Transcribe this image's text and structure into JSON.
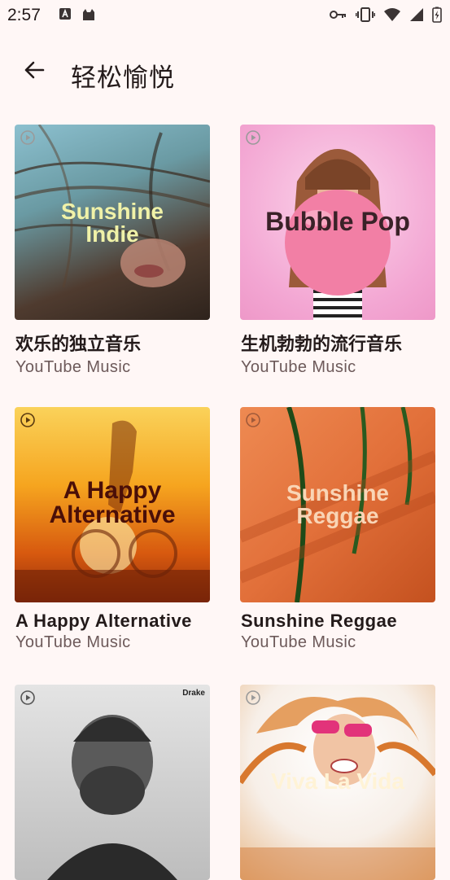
{
  "status": {
    "time": "2:57",
    "left_icons": [
      "font-a-icon",
      "cat-icon"
    ],
    "right_icons": [
      "key-icon",
      "vibrate-icon",
      "wifi-icon",
      "signal-icon",
      "battery-charging-icon"
    ]
  },
  "header": {
    "title": "轻松愉悦",
    "back_icon": "arrow-left-icon"
  },
  "playlists": [
    {
      "title": "欢乐的独立音乐",
      "subtitle": "YouTube Music",
      "art_text": "Sunshine Indie",
      "art_colors": [
        "#7fb2c2",
        "#5e4a3a"
      ]
    },
    {
      "title": "生机勃勃的流行音乐",
      "subtitle": "YouTube Music",
      "art_text": "Bubble Pop",
      "art_colors": [
        "#f4b7d9",
        "#f07fa0"
      ]
    },
    {
      "title": "A Happy Alternative",
      "subtitle": "YouTube Music",
      "art_text": "A Happy Alternative",
      "art_colors": [
        "#f7c13a",
        "#c2430f"
      ]
    },
    {
      "title": "Sunshine Reggae",
      "subtitle": "YouTube Music",
      "art_text": "Sunshine Reggae",
      "art_colors": [
        "#e97a43",
        "#c54e22"
      ]
    },
    {
      "title": "",
      "subtitle": "",
      "art_text": "Drake",
      "art_colors": [
        "#d9d9d9",
        "#3a3a3a"
      ]
    },
    {
      "title": "",
      "subtitle": "",
      "art_text": "Viva La Vida",
      "art_colors": [
        "#f6f0ea",
        "#e08a3c"
      ]
    }
  ]
}
